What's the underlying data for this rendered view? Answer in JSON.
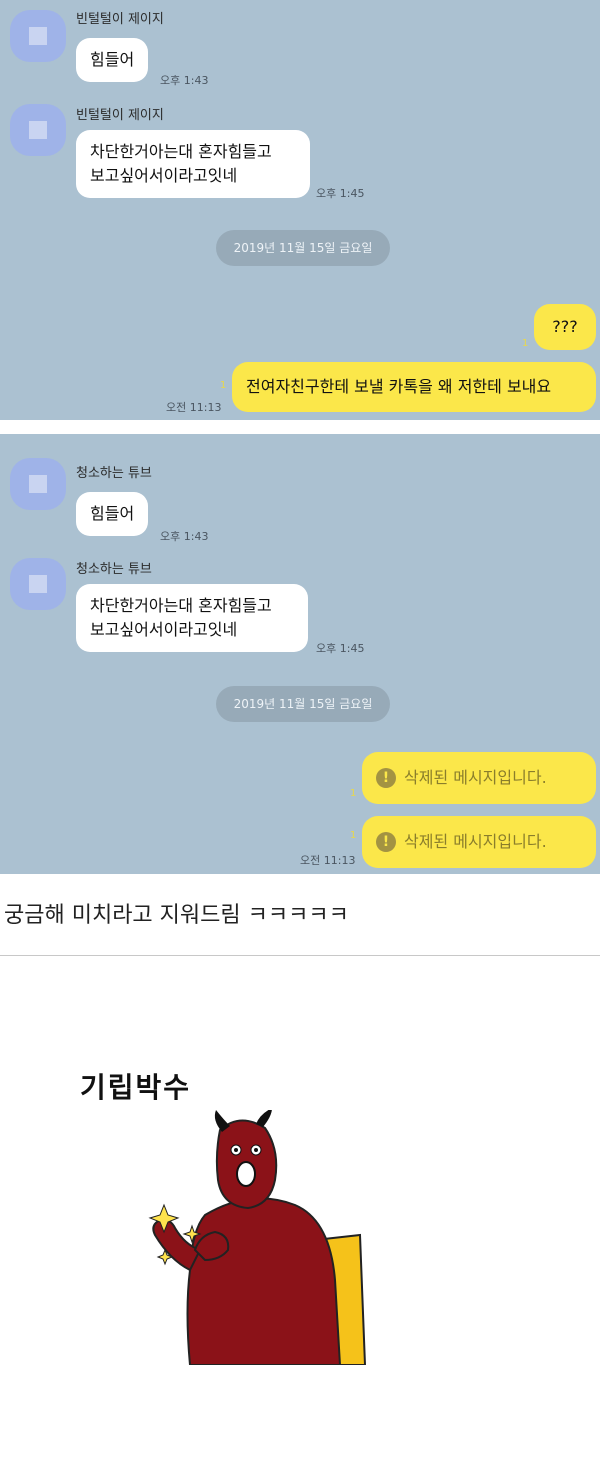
{
  "panel1": {
    "messages": [
      {
        "sender": "빈털털이 제이지",
        "text": "힘들어",
        "time": "오후 1:43"
      },
      {
        "sender": "빈털털이 제이지",
        "text": "차단한거아는대 혼자힘들고\n보고싶어서이라고잇네",
        "time": "오후 1:45"
      }
    ],
    "date_divider": "2019년 11월 15일 금요일",
    "my_messages": [
      {
        "text": "???",
        "read": "1"
      },
      {
        "text": "전여자친구한테 보낼 카톡을 왜 저한테 보내요",
        "read": "1",
        "time": "오전 11:13"
      }
    ]
  },
  "panel2": {
    "messages": [
      {
        "sender": "청소하는 튜브",
        "text": "힘들어",
        "time": "오후 1:43"
      },
      {
        "sender": "청소하는 튜브",
        "text": "차단한거아는대 혼자힘들고\n보고싶어서이라고잇네",
        "time": "오후 1:45"
      }
    ],
    "date_divider": "2019년 11월 15일 금요일",
    "my_messages": [
      {
        "text": "삭제된 메시지입니다.",
        "read": "1"
      },
      {
        "text": "삭제된 메시지입니다.",
        "read": "1",
        "time": "오전 11:13"
      }
    ],
    "warn_glyph": "!"
  },
  "caption": "궁금해 미치라고 지워드림 ㅋㅋㅋㅋㅋ",
  "meme": {
    "title": "기립박수",
    "icon": "applauding-devil-illustration"
  },
  "colors": {
    "chat_bg": "#abc1d1",
    "my_bubble": "#fbe74a",
    "devil": "#8b1218",
    "chair": "#f5c21a"
  }
}
